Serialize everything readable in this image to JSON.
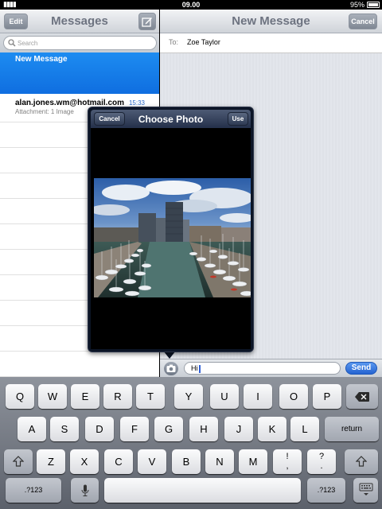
{
  "status_bar": {
    "time": "09.00",
    "battery": "95%"
  },
  "left_pane": {
    "title": "Messages",
    "edit_label": "Edit",
    "search_placeholder": "Search",
    "selected_conversation": "New Message",
    "conversations": [
      {
        "name": "alan.jones.wm@hotmail.com",
        "time": "15:33",
        "preview": "Attachment: 1 Image"
      }
    ]
  },
  "right_pane": {
    "title": "New Message",
    "cancel_label": "Cancel",
    "to_label": "To:",
    "to_value": "Zoe Taylor"
  },
  "compose": {
    "text": "Hi",
    "send_label": "Send"
  },
  "popover": {
    "title": "Choose Photo",
    "cancel_label": "Cancel",
    "use_label": "Use"
  },
  "keyboard": {
    "row1": [
      "Q",
      "W",
      "E",
      "R",
      "T",
      "Y",
      "U",
      "I",
      "O",
      "P"
    ],
    "row2": [
      "A",
      "S",
      "D",
      "F",
      "G",
      "H",
      "J",
      "K",
      "L"
    ],
    "row3": [
      "Z",
      "X",
      "C",
      "V",
      "B",
      "N",
      "M"
    ],
    "punct1": [
      "!",
      ","
    ],
    "punct2": [
      "?",
      "."
    ],
    "return_label": "return",
    "numbers_label": ".?123"
  },
  "icons": [
    "compose-icon",
    "search-icon",
    "camera-icon",
    "backspace-icon",
    "shift-icon",
    "microphone-icon",
    "keyboard-hide-icon"
  ]
}
